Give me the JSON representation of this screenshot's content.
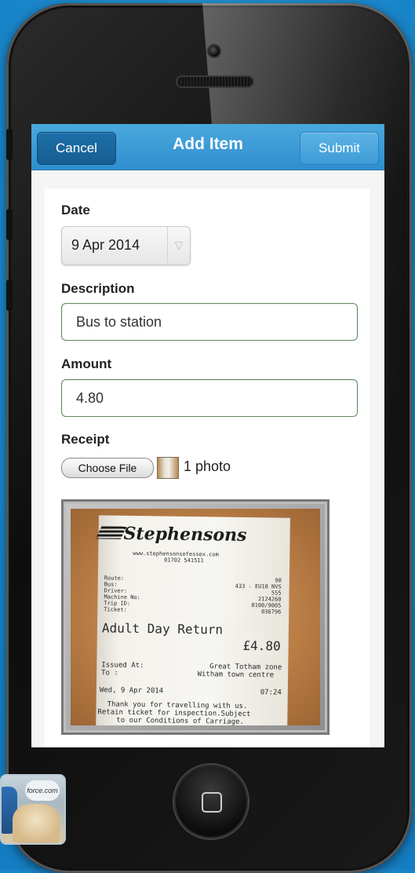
{
  "navbar": {
    "cancel_label": "Cancel",
    "title": "Add Item",
    "submit_label": "Submit"
  },
  "form": {
    "date_label": "Date",
    "date_value": "9 Apr 2014",
    "description_label": "Description",
    "description_value": "Bus to station",
    "amount_label": "Amount",
    "amount_value": "4.80",
    "receipt_label": "Receipt",
    "choose_file_label": "Choose File",
    "photo_count": "1 photo"
  },
  "receipt": {
    "company": "Stephensons",
    "website": "www.stephensonsofessex.com",
    "phone": "01702 541511",
    "route_label": "Route:",
    "route_value": "90",
    "bus_label": "Bus:",
    "bus_value": "433 - EU10 NVS",
    "driver_label": "Driver:",
    "driver_value": "555",
    "machine_label": "Machine No:",
    "machine_value": "2124260",
    "trip_label": "Trip ID:",
    "trip_value": "0100/9005",
    "ticket_label": "Ticket:",
    "ticket_value": "036796",
    "ticket_type": "Adult Day Return",
    "price": "£4.80",
    "issued_label": "Issued At:",
    "issued_value": "Great Totham zone",
    "to_label": "To   :",
    "to_value": "Witham town centre",
    "date": "Wed, 9 Apr 2014",
    "time": "07:24",
    "thanks_1": "Thank you for travelling with us.",
    "thanks_2": "Retain ticket for inspection.Subject",
    "thanks_3": "to our Conditions of Carriage."
  },
  "avatar_badge": "force.com"
}
